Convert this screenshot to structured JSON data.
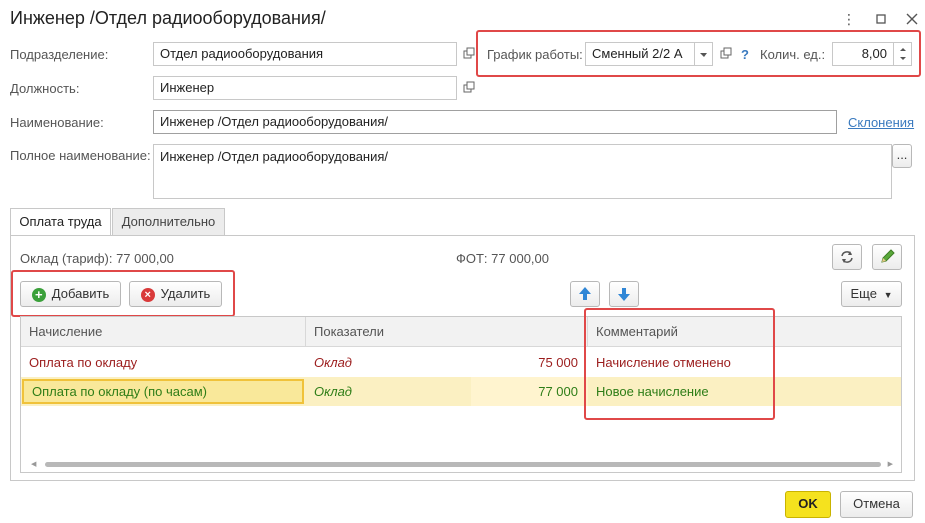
{
  "window": {
    "title": "Инженер /Отдел радиооборудования/"
  },
  "form": {
    "division_label": "Подразделение:",
    "division_value": "Отдел радиооборудования",
    "position_label": "Должность:",
    "position_value": "Инженер",
    "name_label": "Наименование:",
    "name_value": "Инженер /Отдел радиооборудования/",
    "declension_link": "Склонения",
    "full_name_label": "Полное наименование:",
    "full_name_value": "Инженер /Отдел радиооборудования/",
    "more_btn": "...",
    "schedule_label": "График работы:",
    "schedule_value": "Сменный 2/2 А",
    "help": "?",
    "units_label": "Колич. ед.:",
    "units_value": "8,00"
  },
  "tabs": [
    {
      "label": "Оплата труда"
    },
    {
      "label": "Дополнительно"
    }
  ],
  "pay": {
    "salary_text": "Оклад (тариф): 77 000,00",
    "fot_text": "ФОТ: 77 000,00",
    "add_label": "Добавить",
    "delete_label": "Удалить",
    "more_label": "Еще"
  },
  "table": {
    "headers": [
      "Начисление",
      "Показатели",
      "Комментарий"
    ],
    "rows": [
      {
        "accrual": "Оплата по окладу",
        "indicator": "Оклад",
        "amount": "75 000",
        "comment": "Начисление отменено"
      },
      {
        "accrual": "Оплата по окладу (по часам)",
        "indicator": "Оклад",
        "amount": "77 000",
        "comment": "Новое начисление"
      }
    ]
  },
  "footer": {
    "ok_label": "OK",
    "cancel_label": "Отмена"
  },
  "colors": {
    "highlight_border": "#e04848",
    "selected_row": "#fbf0c2",
    "ok_button": "#f5e21e",
    "cancelled_text": "#9b1c1c",
    "new_text": "#2e7d17"
  }
}
